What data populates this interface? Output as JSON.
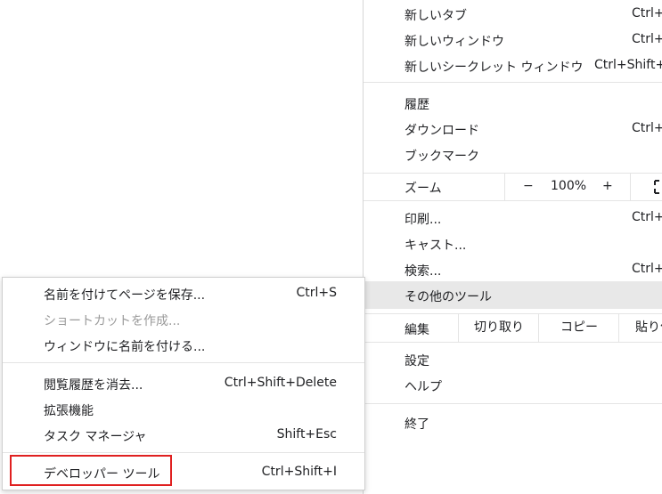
{
  "main_menu": {
    "new_tab": {
      "label": "新しいタブ",
      "shortcut": "Ctrl+"
    },
    "new_window": {
      "label": "新しいウィンドウ",
      "shortcut": "Ctrl+"
    },
    "new_incognito": {
      "label": "新しいシークレット ウィンドウ",
      "shortcut": "Ctrl+Shift+I"
    },
    "history": {
      "label": "履歴"
    },
    "downloads": {
      "label": "ダウンロード",
      "shortcut": "Ctrl+"
    },
    "bookmarks": {
      "label": "ブックマーク"
    },
    "zoom": {
      "label": "ズーム",
      "minus": "−",
      "value": "100%",
      "plus": "+"
    },
    "print": {
      "label": "印刷...",
      "shortcut": "Ctrl+"
    },
    "cast": {
      "label": "キャスト..."
    },
    "find": {
      "label": "検索...",
      "shortcut": "Ctrl+"
    },
    "more_tools": {
      "label": "その他のツール"
    },
    "edit": {
      "label": "編集",
      "cut": "切り取り",
      "copy": "コピー",
      "paste": "貼り付"
    },
    "settings": {
      "label": "設定"
    },
    "help": {
      "label": "ヘルプ"
    },
    "exit": {
      "label": "終了"
    }
  },
  "sub_menu": {
    "save_page": {
      "label": "名前を付けてページを保存...",
      "shortcut": "Ctrl+S"
    },
    "create_shortcut": {
      "label": "ショートカットを作成..."
    },
    "name_window": {
      "label": "ウィンドウに名前を付ける..."
    },
    "clear_history": {
      "label": "閲覧履歴を消去...",
      "shortcut": "Ctrl+Shift+Delete"
    },
    "extensions": {
      "label": "拡張機能"
    },
    "task_manager": {
      "label": "タスク マネージャ",
      "shortcut": "Shift+Esc"
    },
    "developer_tools": {
      "label": "デベロッパー ツール",
      "shortcut": "Ctrl+Shift+I"
    }
  },
  "colors": {
    "highlight_border": "#e02020",
    "hover_bg": "#e8e8e8"
  }
}
